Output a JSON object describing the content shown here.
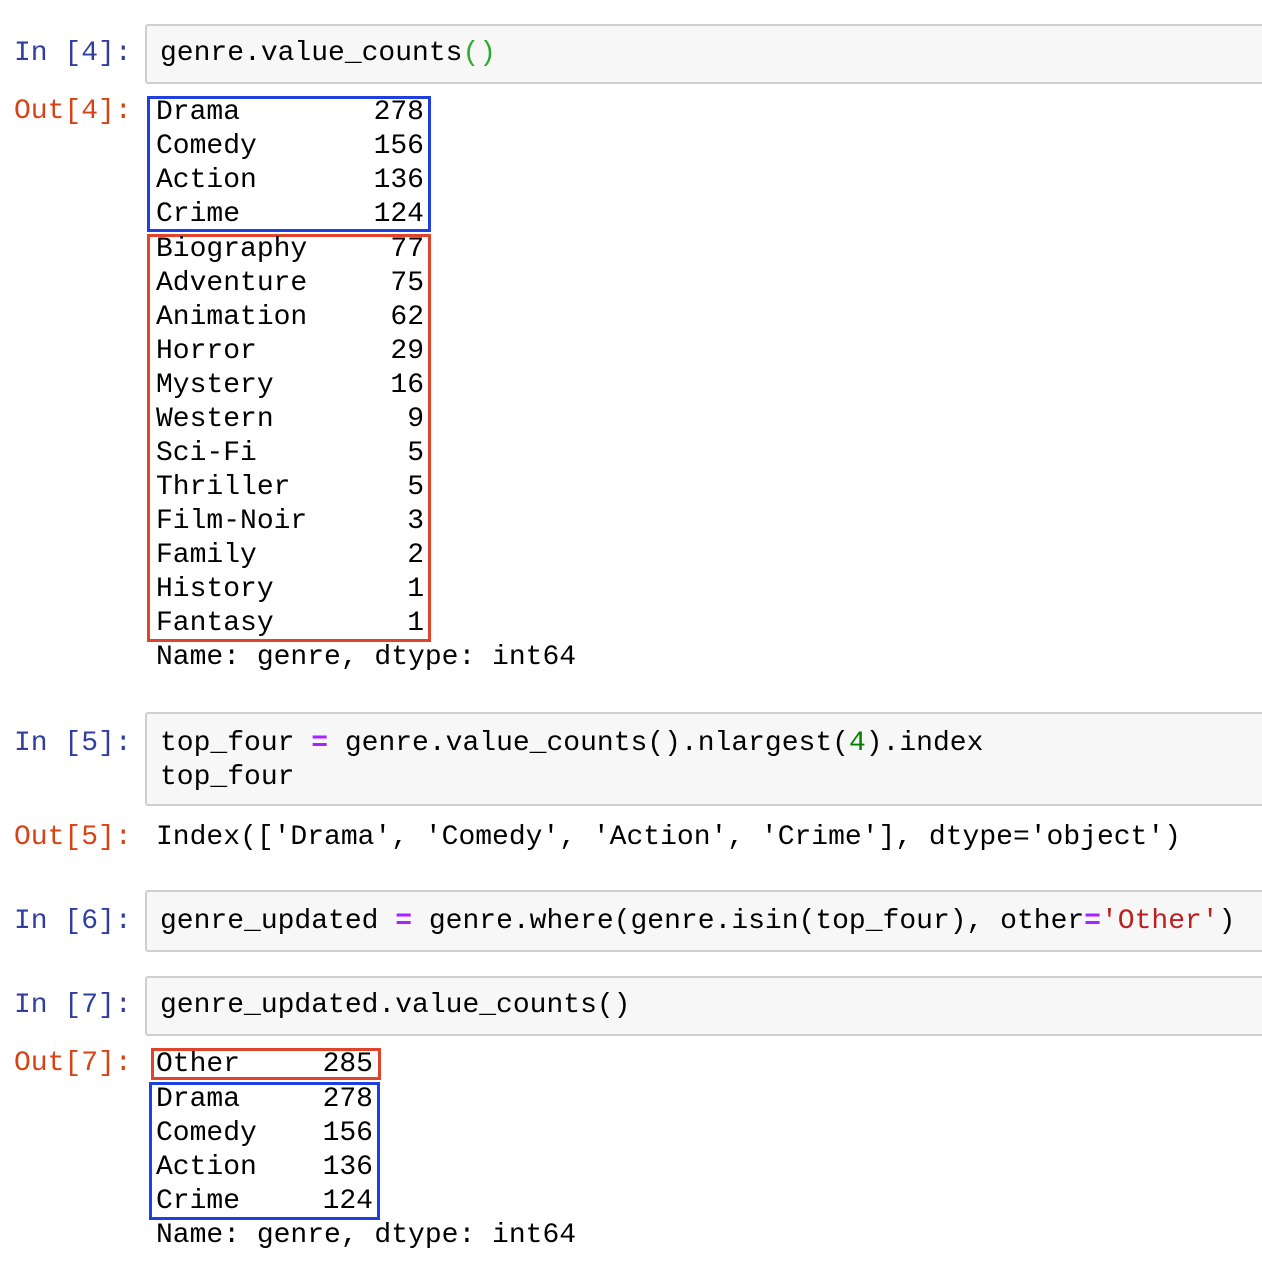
{
  "colors": {
    "in_prompt": "#303f9f",
    "out_prompt": "#d84315",
    "highlight_blue": "#1f3fe0",
    "highlight_red": "#e0442a"
  },
  "cells": [
    {
      "in_prompt": "In [4]:",
      "code": {
        "obj": "genre.value_counts",
        "lp": "(",
        "rp": ")"
      },
      "out_prompt": "Out[4]:",
      "output_top": [
        {
          "label": "Drama",
          "value": "278"
        },
        {
          "label": "Comedy",
          "value": "156"
        },
        {
          "label": "Action",
          "value": "136"
        },
        {
          "label": "Crime",
          "value": "124"
        }
      ],
      "output_rest": [
        {
          "label": "Biography",
          "value": "77"
        },
        {
          "label": "Adventure",
          "value": "75"
        },
        {
          "label": "Animation",
          "value": "62"
        },
        {
          "label": "Horror",
          "value": "29"
        },
        {
          "label": "Mystery",
          "value": "16"
        },
        {
          "label": "Western",
          "value": "9"
        },
        {
          "label": "Sci-Fi",
          "value": "5"
        },
        {
          "label": "Thriller",
          "value": "5"
        },
        {
          "label": "Film-Noir",
          "value": "3"
        },
        {
          "label": "Family",
          "value": "2"
        },
        {
          "label": "History",
          "value": "1"
        },
        {
          "label": "Fantasy",
          "value": "1"
        }
      ],
      "footer": "Name: genre, dtype: int64"
    },
    {
      "in_prompt": "In [5]:",
      "code_line1": {
        "a": "top_four ",
        "op": "=",
        "b": " genre.value_counts().nlargest(",
        "num": "4",
        "c": ").index"
      },
      "code_line2": "top_four",
      "out_prompt": "Out[5]:",
      "output": "Index(['Drama', 'Comedy', 'Action', 'Crime'], dtype='object')"
    },
    {
      "in_prompt": "In [6]:",
      "code": {
        "a": "genre_updated ",
        "op1": "=",
        "b": " genre.where(genre.isin(top_four), other",
        "op2": "=",
        "str": "'Other'",
        "c": ")"
      }
    },
    {
      "in_prompt": "In [7]:",
      "code": "genre_updated.value_counts()",
      "out_prompt": "Out[7]:",
      "output_other": [
        {
          "label": "Other",
          "value": "285"
        }
      ],
      "output_top": [
        {
          "label": "Drama",
          "value": "278"
        },
        {
          "label": "Comedy",
          "value": "156"
        },
        {
          "label": "Action",
          "value": "136"
        },
        {
          "label": "Crime",
          "value": "124"
        }
      ],
      "footer": "Name: genre, dtype: int64"
    }
  ]
}
